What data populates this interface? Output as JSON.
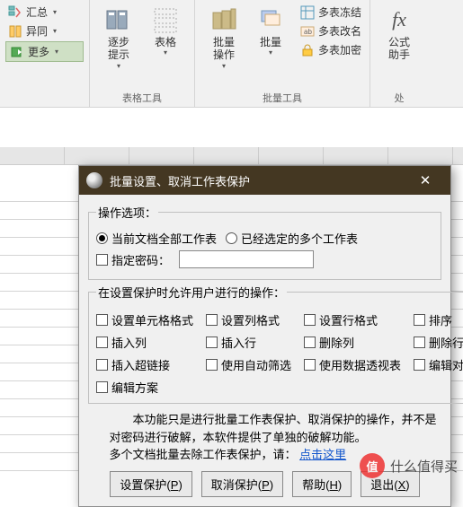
{
  "ribbon": {
    "group1": {
      "summary": "汇总",
      "diff": "异同",
      "more": "更多"
    },
    "group2": {
      "step_hint": "逐步\n提示",
      "table": "表格",
      "label": "表格工具"
    },
    "group3": {
      "batch_op": "批量\n操作",
      "batch": "批量",
      "freeze": "多表冻结",
      "rename": "多表改名",
      "encrypt": "多表加密",
      "label": "批量工具"
    },
    "group4": {
      "fx": "公式\n助手",
      "label": "处"
    }
  },
  "dialog": {
    "title": "批量设置、取消工作表保护",
    "options_legend": "操作选项：",
    "radio_all": "当前文档全部工作表",
    "radio_selected": "已经选定的多个工作表",
    "specify_pwd": "指定密码：",
    "perm_legend": "在设置保护时允许用户进行的操作：",
    "perms": [
      "设置单元格格式",
      "设置列格式",
      "设置行格式",
      "排序",
      "插入列",
      "插入行",
      "删除列",
      "删除行",
      "插入超链接",
      "使用自动筛选",
      "使用数据透视表",
      "编辑对象",
      "编辑方案"
    ],
    "note_line1": "本功能只是进行批量工作表保护、取消保护的操作，并不是对密码进行破解，本软件提供了单独的破解功能。",
    "note_line2_prefix": "多个文档批量去除工作表保护，请：",
    "note_link": "点击这里",
    "btn_protect": "设置保护(",
    "btn_protect_key": "P",
    "btn_unprotect": "取消保护(",
    "btn_unprotect_key": "P",
    "btn_help": "帮助(",
    "btn_help_key": "H",
    "btn_exit": "退出(",
    "btn_exit_key": "X",
    "btn_close_paren": ")"
  },
  "watermark": {
    "logo": "值",
    "text": "什么值得买"
  }
}
